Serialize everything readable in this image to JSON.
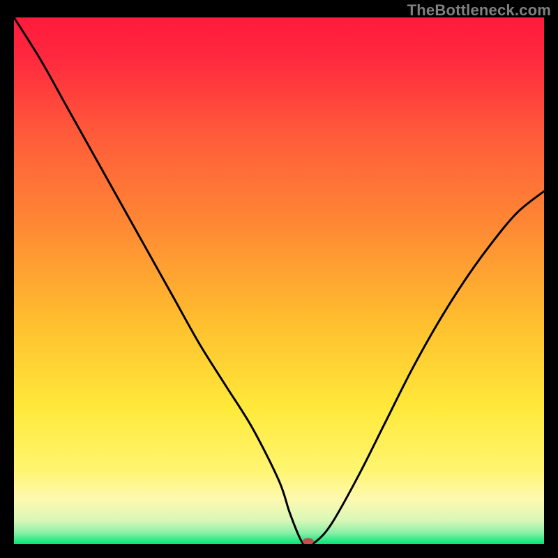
{
  "watermark": "TheBottleneck.com",
  "chart_data": {
    "type": "line",
    "title": "",
    "xlabel": "",
    "ylabel": "",
    "xlim": [
      0,
      100
    ],
    "ylim": [
      0,
      100
    ],
    "legend": false,
    "grid": false,
    "background_gradient": {
      "top_color": "#ff1744",
      "mid_color": "#ffe040",
      "bottom_band_color": "#fff59d",
      "bottom_edge_color": "#00e676"
    },
    "series": [
      {
        "name": "curve",
        "x": [
          0,
          5,
          10,
          15,
          20,
          25,
          30,
          35,
          40,
          45,
          50,
          52,
          54,
          55,
          57,
          60,
          65,
          70,
          75,
          80,
          85,
          90,
          95,
          100
        ],
        "values": [
          100,
          92,
          83,
          74,
          65,
          56,
          47,
          38,
          30,
          22,
          12,
          6,
          1,
          0,
          0.5,
          4,
          13,
          23,
          33,
          42,
          50,
          57,
          63,
          67
        ]
      }
    ],
    "marker": {
      "x": 55.5,
      "y": 0.5,
      "color": "#c0504d",
      "rx": 8,
      "ry": 5
    }
  }
}
